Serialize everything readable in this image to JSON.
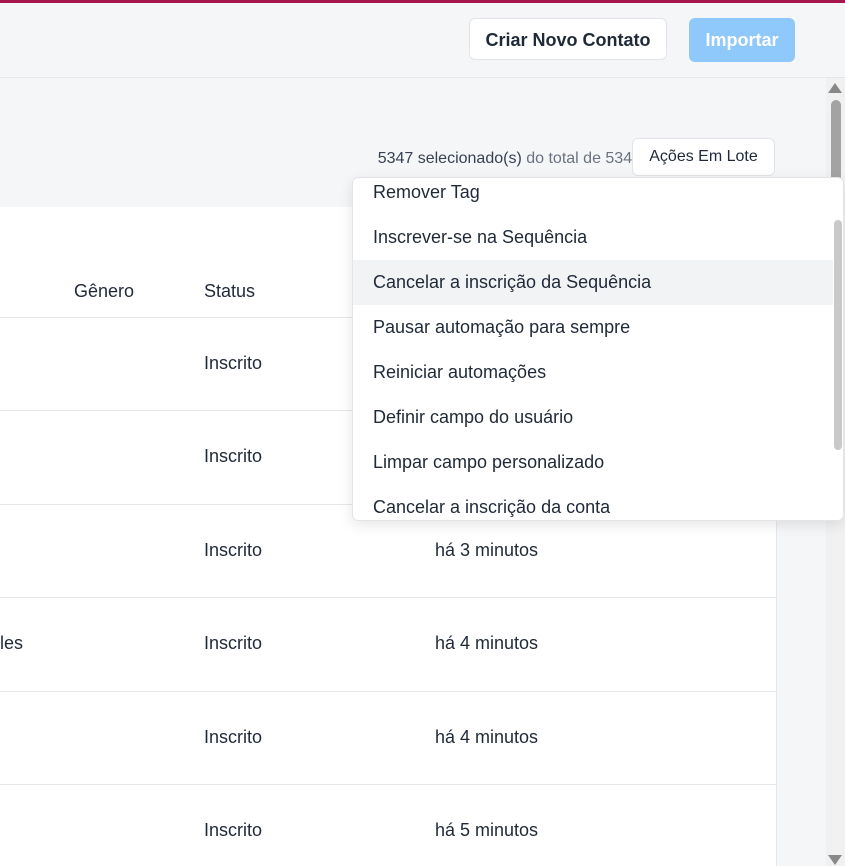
{
  "header": {
    "create_contact_label": "Criar Novo Contato",
    "import_label": "Importar",
    "colors": {
      "accent_top": "#a8164f",
      "import_bg": "#8fc8fa"
    }
  },
  "toolbar": {
    "selected_text": "5347 selecionado(s)",
    "total_text": "do total de 5347",
    "batch_actions_label": "Ações Em Lote"
  },
  "table": {
    "columns": [
      "Gênero",
      "Status"
    ],
    "rows": [
      {
        "name_partial": "",
        "status": "Inscrito",
        "time": ""
      },
      {
        "name_partial": "",
        "status": "Inscrito",
        "time": ""
      },
      {
        "name_partial": "",
        "status": "Inscrito",
        "time": "há 3 minutos"
      },
      {
        "name_partial": "les",
        "status": "Inscrito",
        "time": "há 4 minutos"
      },
      {
        "name_partial": "",
        "status": "Inscrito",
        "time": "há 4 minutos"
      },
      {
        "name_partial": "",
        "status": "Inscrito",
        "time": "há 5 minutos"
      }
    ]
  },
  "dropdown": {
    "items": [
      "Remover Tag",
      "Inscrever-se na Sequência",
      "Cancelar a inscrição da Sequência",
      "Pausar automação para sempre",
      "Reiniciar automações",
      "Definir campo do usuário",
      "Limpar campo personalizado",
      "Cancelar a inscrição da conta"
    ],
    "highlighted_item": "Cancelar a inscrição da Sequência"
  }
}
